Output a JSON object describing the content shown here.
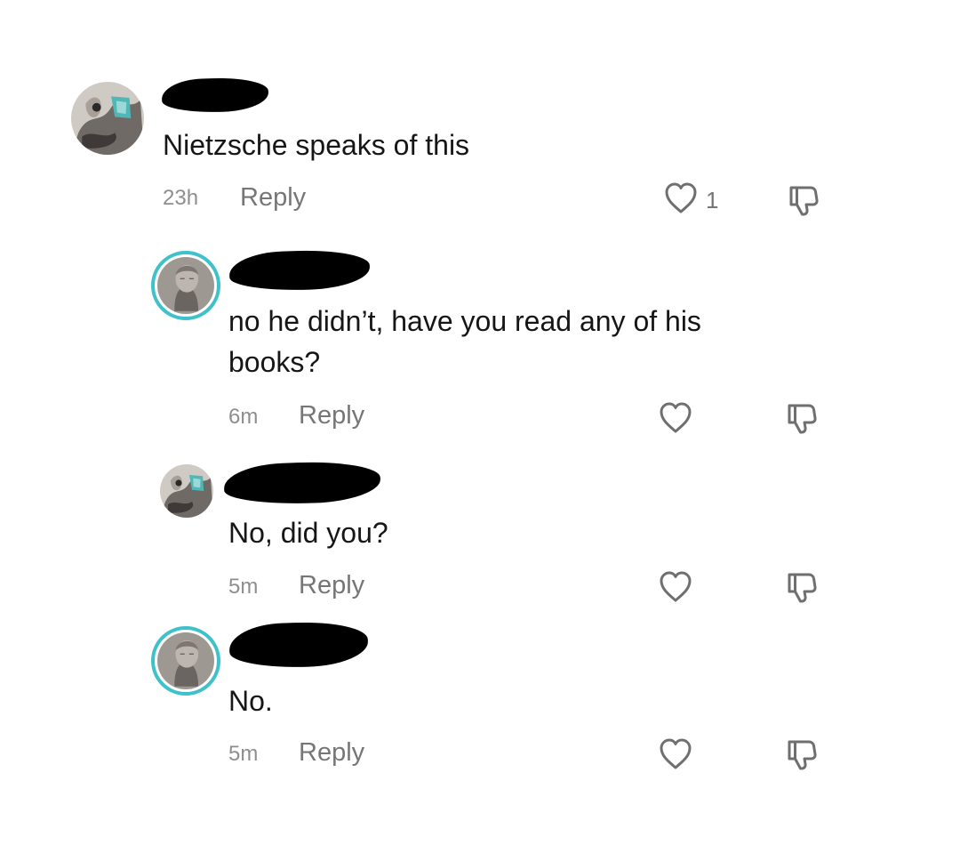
{
  "comments": [
    {
      "text": "Nietzsche speaks of this",
      "time": "23h",
      "reply_label": "Reply",
      "like_count": "1",
      "avatar": "statue-art-avatar"
    },
    {
      "text": "no he didn’t, have you read any of his\nbooks?",
      "time": "6m",
      "reply_label": "Reply",
      "like_count": "",
      "avatar": "bust-avatar"
    },
    {
      "text": "No, did you?",
      "time": "5m",
      "reply_label": "Reply",
      "like_count": "",
      "avatar": "statue-art-avatar"
    },
    {
      "text": "No.",
      "time": "5m",
      "reply_label": "Reply",
      "like_count": "",
      "avatar": "bust-avatar"
    }
  ],
  "colors": {
    "accent_ring": "#3fc1c9",
    "secondary_text": "#767676",
    "redaction": "#000000"
  },
  "icons": [
    "heart-outline-icon",
    "thumbs-down-outline-icon"
  ]
}
